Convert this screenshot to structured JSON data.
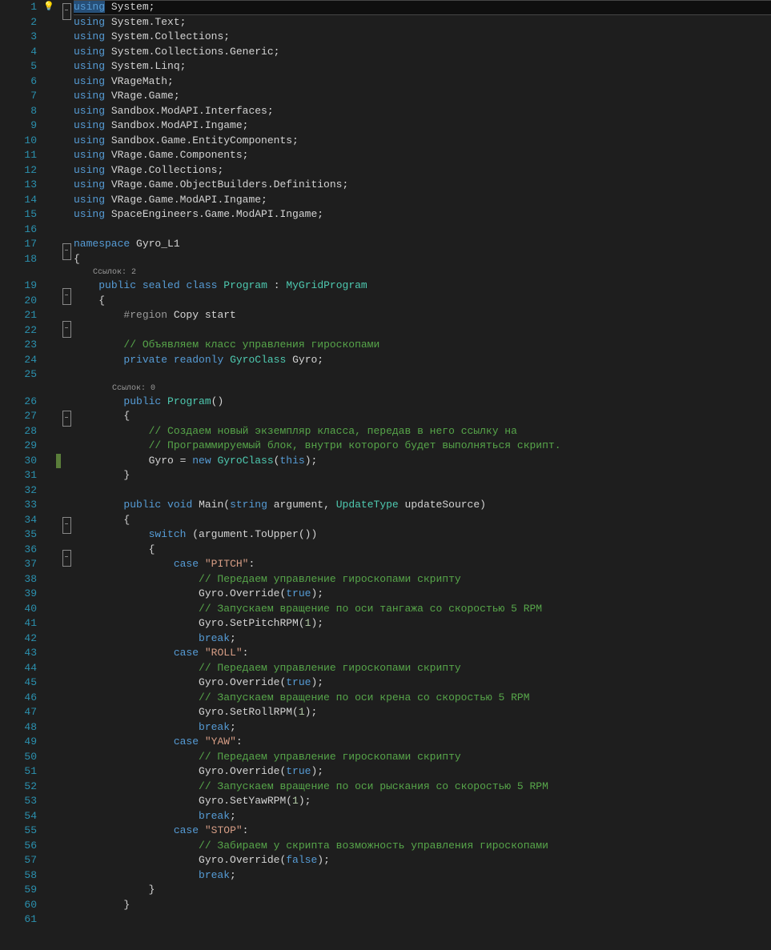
{
  "codelens": {
    "refs2": "Ссылок: 2",
    "refs0": "Ссылок: 0"
  },
  "lines": [
    {
      "n": 1,
      "bulb": true,
      "fold": "minus",
      "html": "<span class='kw'><span class='sel'>using</span></span> System;",
      "hl": true
    },
    {
      "n": 2,
      "html": "<span class='kw'>using</span> System.Text;"
    },
    {
      "n": 3,
      "html": "<span class='kw'>using</span> System.Collections;"
    },
    {
      "n": 4,
      "html": "<span class='kw'>using</span> System.Collections.Generic;"
    },
    {
      "n": 5,
      "html": "<span class='kw'>using</span> System.Linq;"
    },
    {
      "n": 6,
      "html": "<span class='kw'>using</span> VRageMath;"
    },
    {
      "n": 7,
      "html": "<span class='kw'>using</span> VRage.Game;"
    },
    {
      "n": 8,
      "html": "<span class='kw'>using</span> Sandbox.ModAPI.Interfaces;"
    },
    {
      "n": 9,
      "html": "<span class='kw'>using</span> Sandbox.ModAPI.Ingame;"
    },
    {
      "n": 10,
      "html": "<span class='kw'>using</span> Sandbox.Game.EntityComponents;"
    },
    {
      "n": 11,
      "html": "<span class='kw'>using</span> VRage.Game.Components;"
    },
    {
      "n": 12,
      "html": "<span class='kw'>using</span> VRage.Collections;"
    },
    {
      "n": 13,
      "html": "<span class='kw'>using</span> VRage.Game.ObjectBuilders.Definitions;"
    },
    {
      "n": 14,
      "html": "<span class='kw'>using</span> VRage.Game.ModAPI.Ingame;"
    },
    {
      "n": 15,
      "html": "<span class='kw'>using</span> SpaceEngineers.Game.ModAPI.Ingame;"
    },
    {
      "n": 16,
      "html": ""
    },
    {
      "n": 17,
      "fold": "minus",
      "html": "<span class='kw'>namespace</span> Gyro_L1"
    },
    {
      "n": 18,
      "html": "{"
    },
    {
      "codelens": "refs2",
      "indent": "    "
    },
    {
      "n": 19,
      "fold": "minus",
      "html": "    <span class='kw'>public</span> <span class='kw'>sealed</span> <span class='kw'>class</span> <span class='type'>Program</span> : <span class='type'>MyGridProgram</span>"
    },
    {
      "n": 20,
      "html": "    {"
    },
    {
      "n": 21,
      "fold": "minus",
      "html": "        <span class='region'>#region</span> Copy start"
    },
    {
      "n": 22,
      "html": ""
    },
    {
      "n": 23,
      "html": "        <span class='com'>// Объявляем класс управления гироскопами</span>"
    },
    {
      "n": 24,
      "html": "        <span class='kw'>private</span> <span class='kw'>readonly</span> <span class='type'>GyroClass</span> Gyro;"
    },
    {
      "n": 25,
      "html": ""
    },
    {
      "codelens": "refs0",
      "indent": "        "
    },
    {
      "n": 26,
      "fold": "minus",
      "html": "        <span class='kw'>public</span> <span class='type'>Program</span>()"
    },
    {
      "n": 27,
      "html": "        {"
    },
    {
      "n": 28,
      "html": "            <span class='com'>// Создаем новый экземпляр класса, передав в него ссылку на</span>"
    },
    {
      "n": 29,
      "html": "            <span class='com'>// Программируемый блок, внутри которого будет выполняться скрипт.</span>"
    },
    {
      "n": 30,
      "marker": true,
      "html": "            Gyro = <span class='kw'>new</span> <span class='type'>GyroClass</span>(<span class='kw'>this</span>);"
    },
    {
      "n": 31,
      "html": "        }"
    },
    {
      "n": 32,
      "html": ""
    },
    {
      "n": 33,
      "fold": "minus",
      "html": "        <span class='kw'>public</span> <span class='kw'>void</span> Main(<span class='kw'>string</span> argument, <span class='type'>UpdateType</span> updateSource)"
    },
    {
      "n": 34,
      "html": "        {"
    },
    {
      "n": 35,
      "fold": "minus",
      "html": "            <span class='kw'>switch</span> (argument.ToUpper())"
    },
    {
      "n": 36,
      "html": "            {"
    },
    {
      "n": 37,
      "html": "                <span class='kw'>case</span> <span class='str'>\"PITCH\"</span>:"
    },
    {
      "n": 38,
      "html": "                    <span class='com'>// Передаем управление гироскопами скрипту</span>"
    },
    {
      "n": 39,
      "html": "                    Gyro.Override(<span class='kw'>true</span>);"
    },
    {
      "n": 40,
      "html": "                    <span class='com'>// Запускаем вращение по оси тангажа со скоростью 5 RPM</span>"
    },
    {
      "n": 41,
      "html": "                    Gyro.SetPitchRPM(<span class='num'>1</span>);"
    },
    {
      "n": 42,
      "html": "                    <span class='kw'>break</span>;"
    },
    {
      "n": 43,
      "html": "                <span class='kw'>case</span> <span class='str'>\"ROLL\"</span>:"
    },
    {
      "n": 44,
      "html": "                    <span class='com'>// Передаем управление гироскопами скрипту</span>"
    },
    {
      "n": 45,
      "html": "                    Gyro.Override(<span class='kw'>true</span>);"
    },
    {
      "n": 46,
      "html": "                    <span class='com'>// Запускаем вращение по оси крена со скоростью 5 RPM</span>"
    },
    {
      "n": 47,
      "html": "                    Gyro.SetRollRPM(<span class='num'>1</span>);"
    },
    {
      "n": 48,
      "html": "                    <span class='kw'>break</span>;"
    },
    {
      "n": 49,
      "html": "                <span class='kw'>case</span> <span class='str'>\"YAW\"</span>:"
    },
    {
      "n": 50,
      "html": "                    <span class='com'>// Передаем управление гироскопами скрипту</span>"
    },
    {
      "n": 51,
      "html": "                    Gyro.Override(<span class='kw'>true</span>);"
    },
    {
      "n": 52,
      "html": "                    <span class='com'>// Запускаем вращение по оси рыскания со скоростью 5 RPM</span>"
    },
    {
      "n": 53,
      "html": "                    Gyro.SetYawRPM(<span class='num'>1</span>);"
    },
    {
      "n": 54,
      "html": "                    <span class='kw'>break</span>;"
    },
    {
      "n": 55,
      "html": "                <span class='kw'>case</span> <span class='str'>\"STOP\"</span>:"
    },
    {
      "n": 56,
      "html": "                    <span class='com'>// Забираем у скрипта возможность управления гироскопами</span>"
    },
    {
      "n": 57,
      "html": "                    Gyro.Override(<span class='kw'>false</span>);"
    },
    {
      "n": 58,
      "html": "                    <span class='kw'>break</span>;"
    },
    {
      "n": 59,
      "html": "            }"
    },
    {
      "n": 60,
      "html": "        }"
    },
    {
      "n": 61,
      "html": ""
    }
  ]
}
